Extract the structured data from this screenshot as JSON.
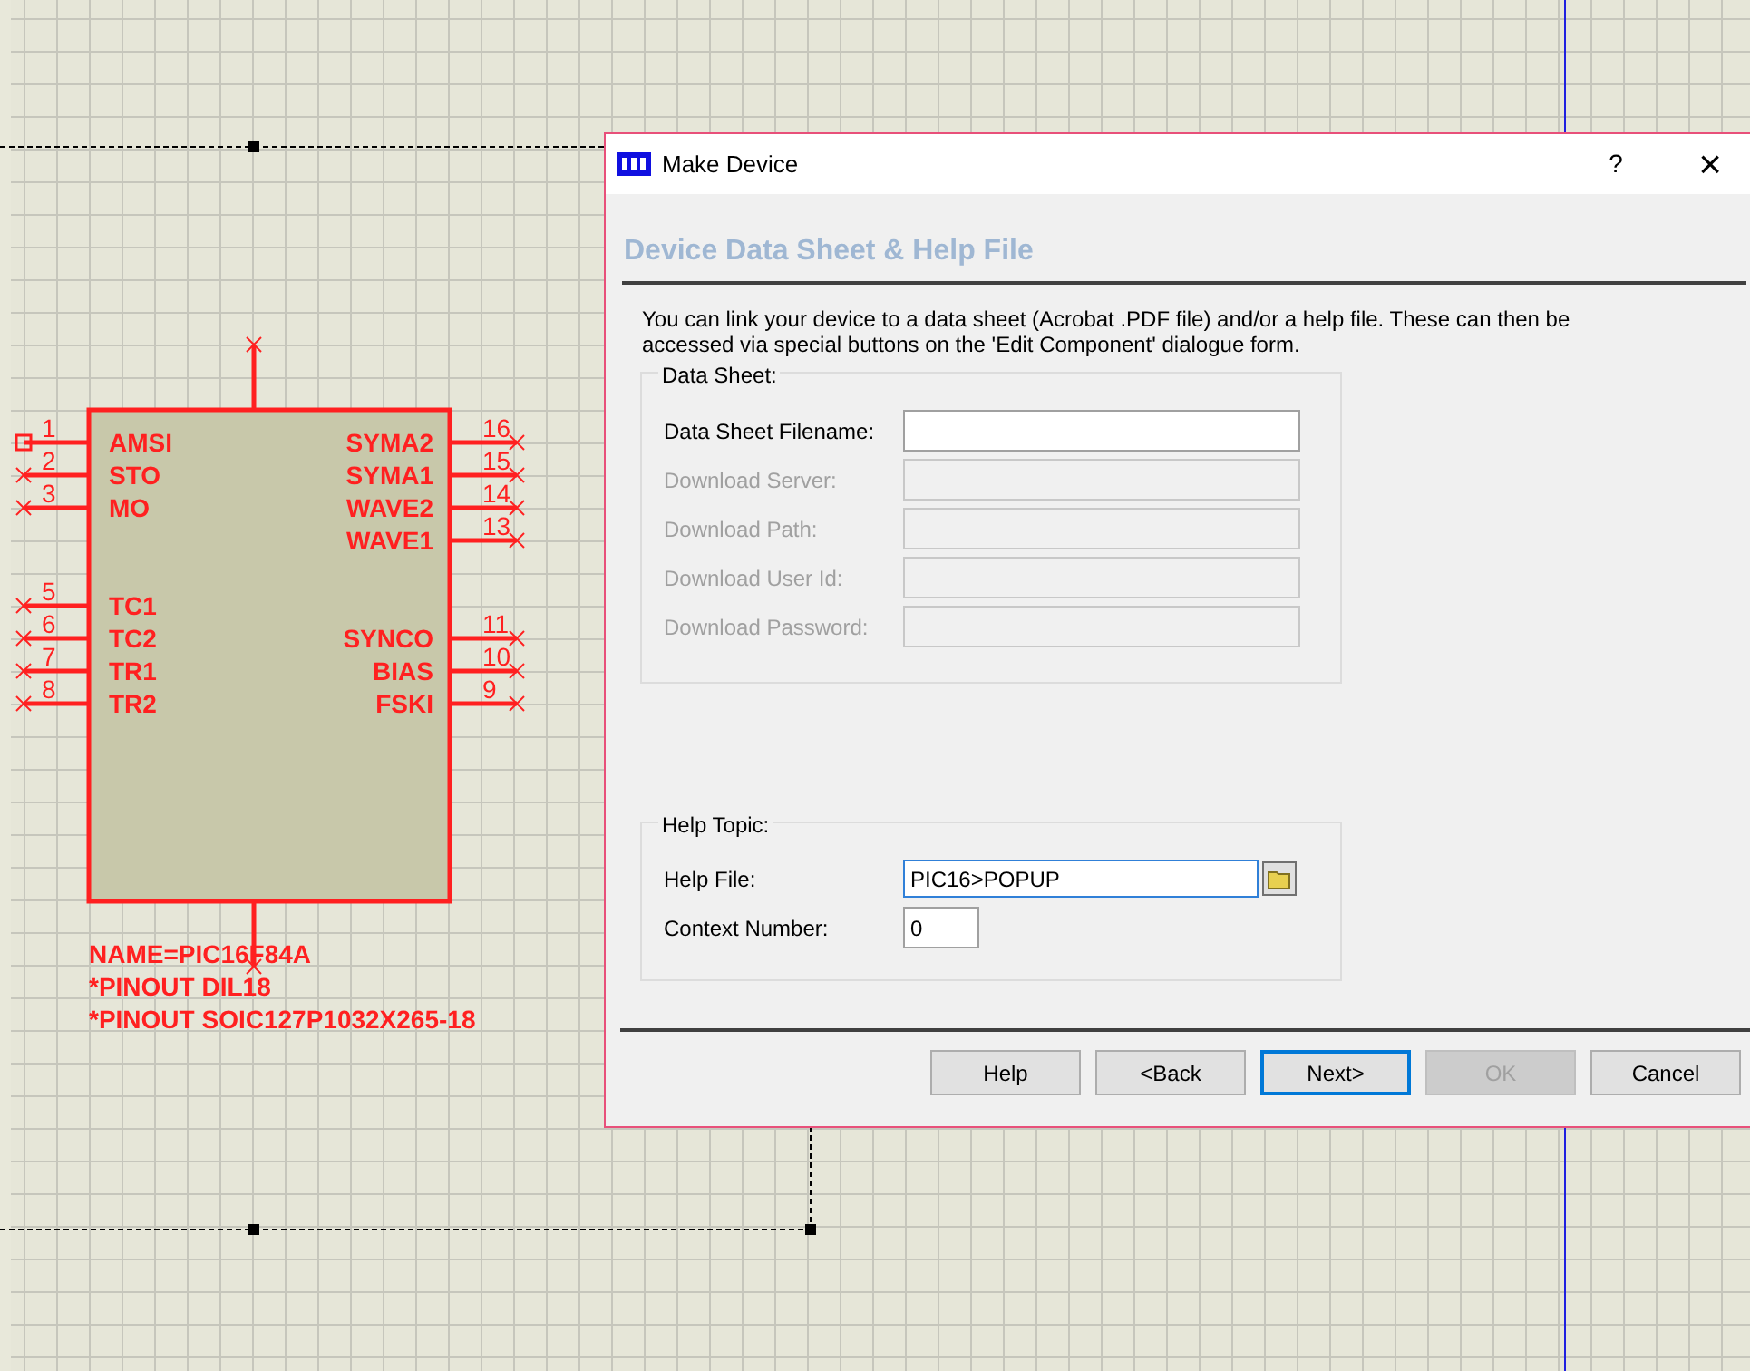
{
  "schematic": {
    "left_pins": [
      {
        "number": "1",
        "name": "AMSI",
        "kind": "connected"
      },
      {
        "number": "2",
        "name": "STO",
        "kind": "open"
      },
      {
        "number": "3",
        "name": "MO",
        "kind": "open"
      },
      {
        "number": "5",
        "name": "TC1",
        "kind": "open"
      },
      {
        "number": "6",
        "name": "TC2",
        "kind": "open"
      },
      {
        "number": "7",
        "name": "TR1",
        "kind": "open"
      },
      {
        "number": "8",
        "name": "TR2",
        "kind": "open"
      }
    ],
    "right_pins": [
      {
        "number": "16",
        "name": "SYMA2",
        "kind": "open"
      },
      {
        "number": "15",
        "name": "SYMA1",
        "kind": "open"
      },
      {
        "number": "14",
        "name": "WAVE2",
        "kind": "open"
      },
      {
        "number": "13",
        "name": "WAVE1",
        "kind": "open"
      },
      {
        "number": "11",
        "name": "SYNCO",
        "kind": "open"
      },
      {
        "number": "10",
        "name": "BIAS",
        "kind": "open"
      },
      {
        "number": "9",
        "name": "FSKI",
        "kind": "open"
      }
    ],
    "properties": [
      "NAME=PIC16F84A",
      "*PINOUT DIL18",
      "*PINOUT SOIC127P1032X265-18"
    ]
  },
  "dialog": {
    "title": "Make Device",
    "help_button": "?",
    "close_button": "×",
    "heading": "Device Data Sheet & Help File",
    "description": "You can link your device to a data sheet (Acrobat .PDF file) and/or a help file. These can then be accessed via special buttons on the 'Edit Component' dialogue form.",
    "data_sheet": {
      "legend": "Data Sheet:",
      "fields": [
        {
          "label": "Data Sheet Filename:",
          "disabled": false
        },
        {
          "label": "Download Server:",
          "disabled": true
        },
        {
          "label": "Download Path:",
          "disabled": true
        },
        {
          "label": "Download User Id:",
          "disabled": true
        },
        {
          "label": "Download Password:",
          "disabled": true
        }
      ]
    },
    "help_topic": {
      "legend": "Help Topic:",
      "help_file": {
        "label": "Help File:",
        "value": "PIC16>POPUP",
        "focused": true
      },
      "context_number": {
        "label": "Context Number:",
        "value": "0"
      }
    },
    "buttons": [
      {
        "label": "Help",
        "disabled": false,
        "focused": false
      },
      {
        "label": "<Back",
        "disabled": false,
        "focused": false
      },
      {
        "label": "Next>",
        "disabled": false,
        "focused": true
      },
      {
        "label": "OK",
        "disabled": true,
        "focused": false
      },
      {
        "label": "Cancel",
        "disabled": false,
        "focused": false
      }
    ]
  }
}
